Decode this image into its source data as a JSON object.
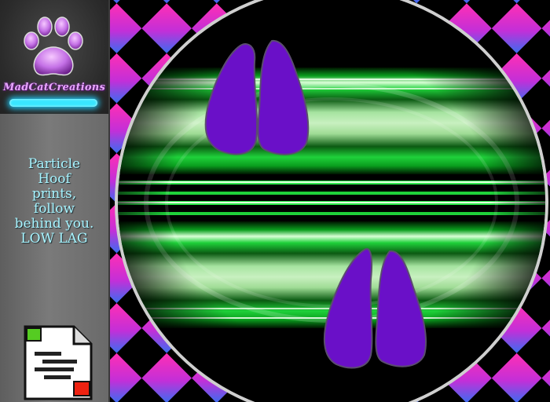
{
  "brand": {
    "name": "MadCatCreations",
    "logo_icon": "paw-print-icon",
    "accent": "#39e6ff"
  },
  "description": {
    "lines": [
      "Particle",
      "Hoof",
      "prints,",
      "follow",
      "behind you.",
      "LOW LAG"
    ]
  },
  "notecard_icon": "notecard-icon",
  "colors": {
    "checker_pink": "#ff2fb4",
    "checker_blue": "#3a6df0",
    "stripe_green": "#1fd13a",
    "hoof_purple": "#6a10c8"
  },
  "hoofprints": [
    {
      "name": "upper-hoofprint",
      "icon": "hoof-print-icon"
    },
    {
      "name": "lower-hoofprint",
      "icon": "hoof-print-icon"
    }
  ]
}
